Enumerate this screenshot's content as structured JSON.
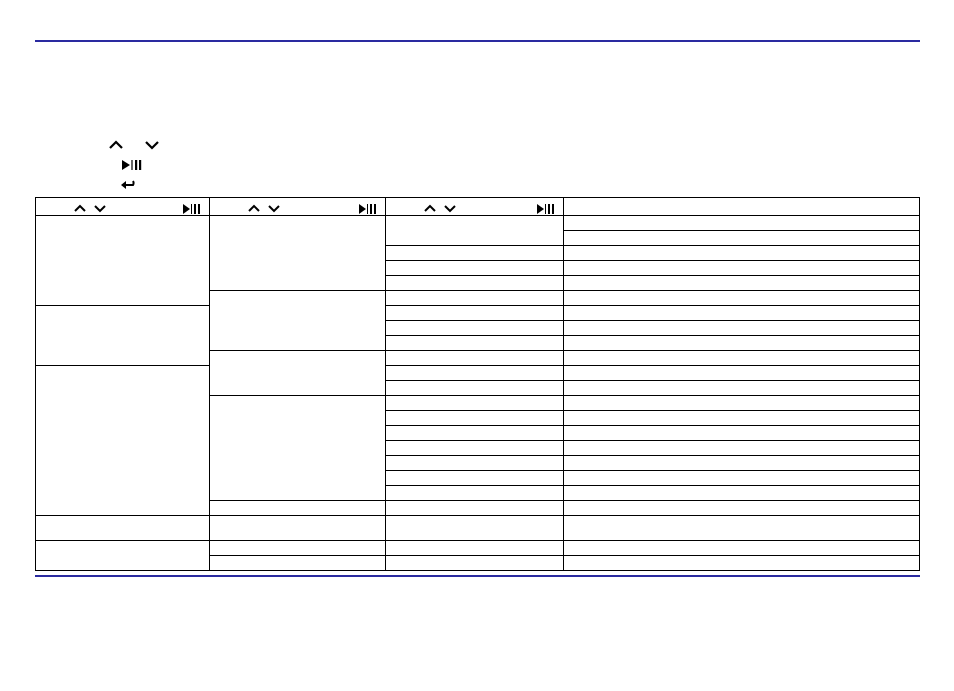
{
  "icons": {
    "chevron_up": "chevron-up",
    "chevron_down": "chevron-down",
    "play_pause": "play/pause",
    "back": "back/return"
  },
  "table": {
    "header_columns": 4,
    "rows_visible": true
  }
}
